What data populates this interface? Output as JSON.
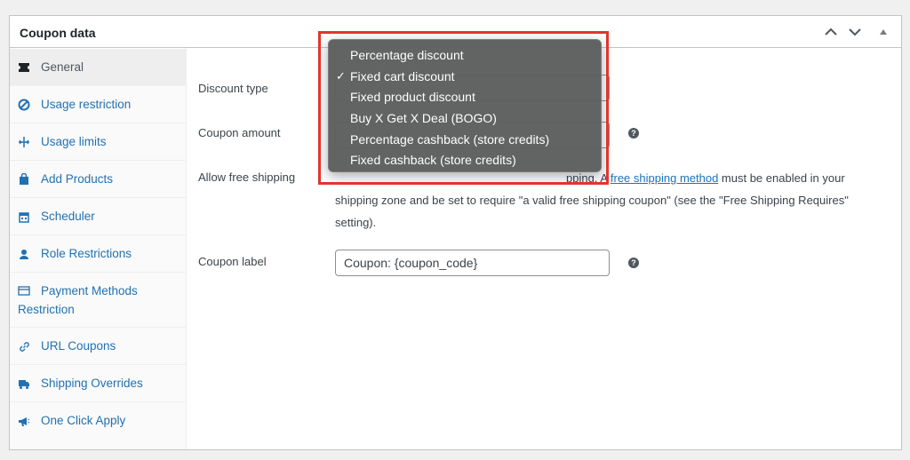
{
  "panel": {
    "title": "Coupon data",
    "controls": [
      "chevron-up",
      "chevron-down",
      "toggle-arrow"
    ]
  },
  "sidebar": {
    "items": [
      {
        "label": "General",
        "icon": "ticket-icon",
        "active": true
      },
      {
        "label": "Usage restriction",
        "icon": "block-icon"
      },
      {
        "label": "Usage limits",
        "icon": "limits-icon"
      },
      {
        "label": "Add Products",
        "icon": "bag-icon"
      },
      {
        "label": "Scheduler",
        "icon": "calendar-icon"
      },
      {
        "label": "Role Restrictions",
        "icon": "user-icon"
      },
      {
        "label": "Payment Methods Restriction",
        "icon": "card-icon"
      },
      {
        "label": "URL Coupons",
        "icon": "link-icon"
      },
      {
        "label": "Shipping Overrides",
        "icon": "truck-icon"
      },
      {
        "label": "One Click Apply",
        "icon": "megaphone-icon"
      }
    ]
  },
  "form": {
    "discount_type_label": "Discount type",
    "coupon_amount_label": "Coupon amount",
    "free_shipping_label": "Allow free shipping",
    "free_shipping_desc_before": "pping. A ",
    "free_shipping_link": "free shipping method",
    "free_shipping_desc_after": " must be enabled in your shipping zone and be set to require \"a valid free shipping coupon\" (see the \"Free Shipping Requires\" setting).",
    "coupon_label_label": "Coupon label",
    "coupon_label_value": "Coupon: {coupon_code}",
    "help_glyph": "?"
  },
  "dropdown": {
    "selected_index": 1,
    "check_glyph": "✓",
    "options": [
      "Percentage discount",
      "Fixed cart discount",
      "Fixed product discount",
      "Buy X Get X Deal (BOGO)",
      "Percentage cashback (store credits)",
      "Fixed cashback (store credits)"
    ]
  },
  "colors": {
    "link": "#2271b1",
    "highlight_border": "#e3342f",
    "dropdown_bg": "#5f6060"
  }
}
